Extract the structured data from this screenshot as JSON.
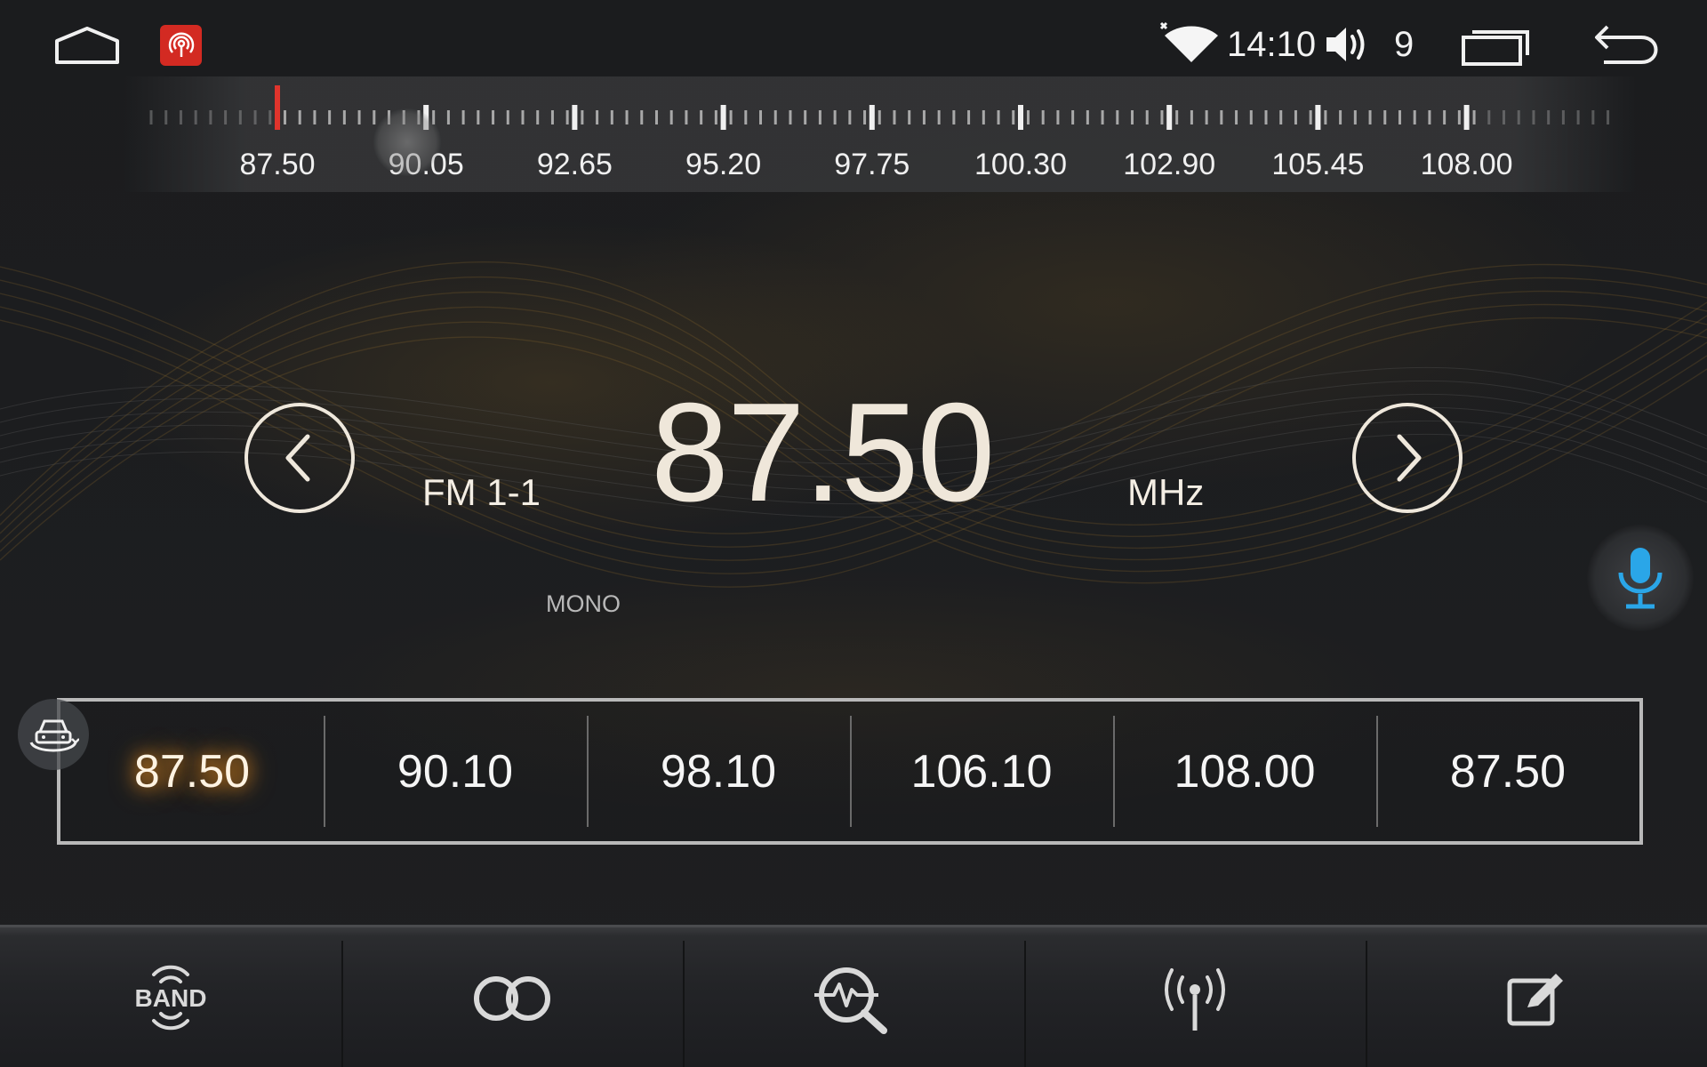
{
  "status_bar": {
    "home_icon": "home-icon",
    "app_icon": "radio-app-icon",
    "wifi_icon": "wifi-icon",
    "time": "14:10",
    "volume_icon": "volume-icon",
    "volume_level": "9",
    "recents_icon": "recents-icon",
    "back_icon": "back-icon"
  },
  "tuner_scale": {
    "labels": [
      "87.50",
      "90.05",
      "92.65",
      "95.20",
      "97.75",
      "100.30",
      "102.90",
      "105.45",
      "108.00"
    ],
    "current_marker": 87.5,
    "marker_color": "#e0342c"
  },
  "main": {
    "band": "FM 1-1",
    "frequency": "87.50",
    "unit": "MHz",
    "stereo_status": "MONO",
    "prev_icon": "chevron-left-icon",
    "next_icon": "chevron-right-icon",
    "mic_icon": "microphone-icon",
    "mic_color": "#2aa6e8"
  },
  "presets": {
    "items": [
      "87.50",
      "90.10",
      "98.10",
      "106.10",
      "108.00",
      "87.50"
    ],
    "active_index": 0,
    "active_glow_color": "#e38a1e",
    "car_icon": "car-mode-icon"
  },
  "bottom_bar": {
    "band_label": "BAND",
    "items": [
      "band-icon",
      "stereo-icon",
      "search-scan-icon",
      "antenna-icon",
      "edit-icon"
    ]
  }
}
